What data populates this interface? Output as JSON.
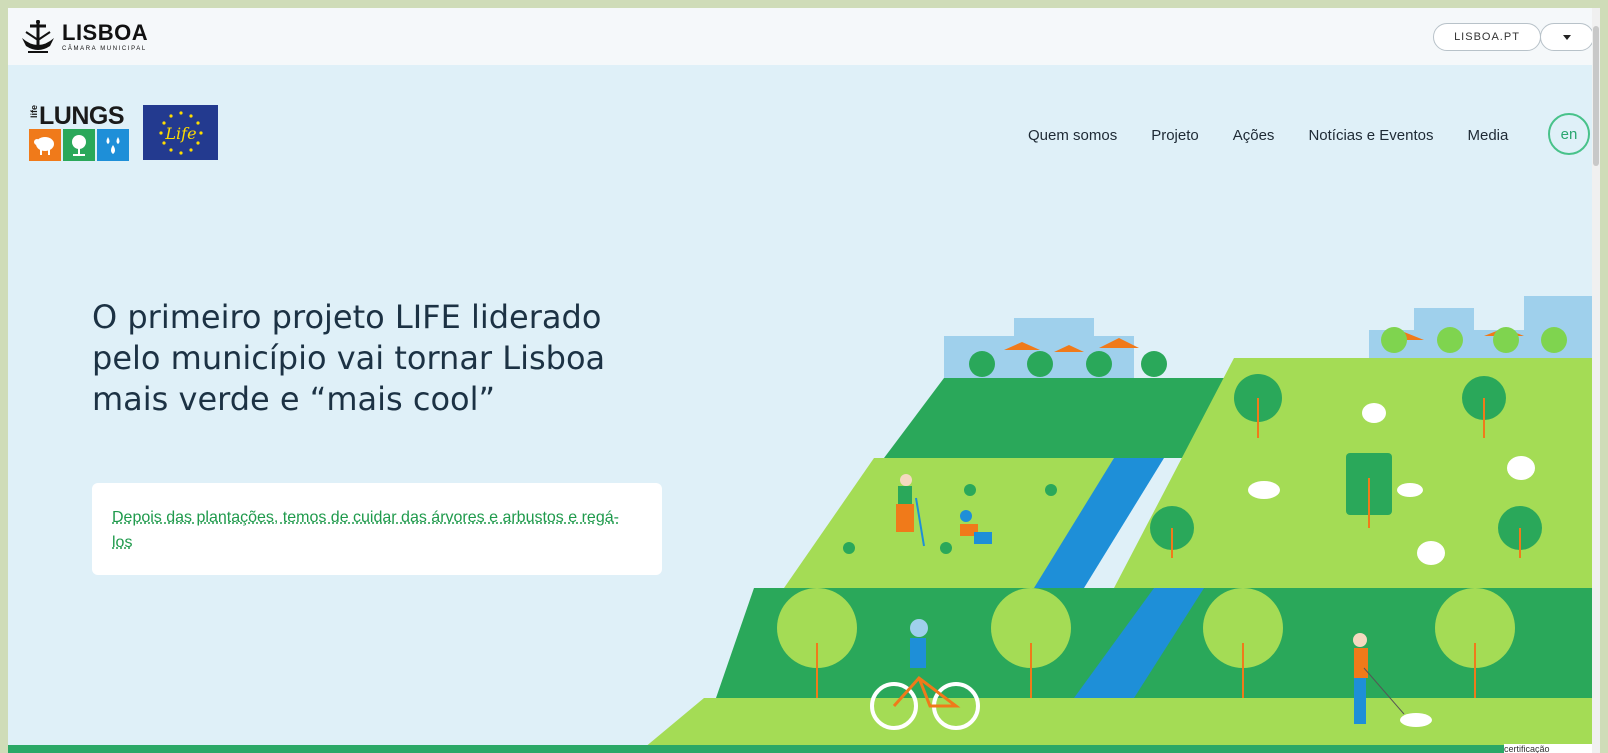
{
  "topbar": {
    "brand_name": "LISBOA",
    "brand_sub": "CÂMARA MUNICIPAL",
    "site_link": "LISBOA.PT"
  },
  "nav": {
    "project_logo_word": "LUNGS",
    "project_logo_prefix": "life",
    "eu_logo_text": "Life",
    "links": [
      "Quem somos",
      "Projeto",
      "Ações",
      "Notícias e Eventos",
      "Media"
    ],
    "language": "en"
  },
  "hero": {
    "headline_line1": "O primeiro projeto LIFE liderado",
    "headline_line2": "pelo município vai tornar Lisboa",
    "headline_line3": "mais verde e “mais cool”",
    "card_link": "Depois das plantações, temos de cuidar das árvores e arbustos e regá-los"
  },
  "cookie_text": "certificação",
  "colors": {
    "page_bg": "#dff0f8",
    "accent_green": "#2aa670",
    "headline": "#1c3244",
    "grass_light": "#a4dc55",
    "grass_dark": "#2aa85a",
    "river": "#1e8fd8",
    "orange": "#f07a1a"
  }
}
